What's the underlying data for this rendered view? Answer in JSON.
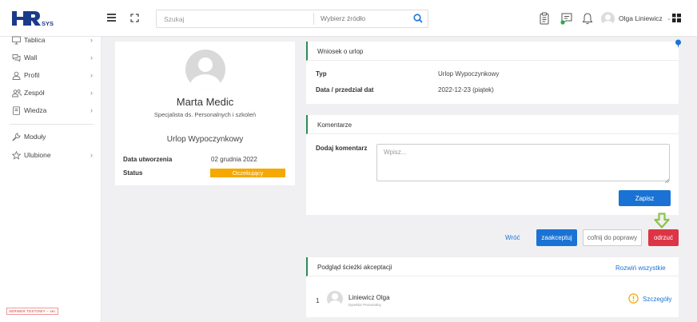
{
  "app": {
    "logo_text": "HRsys",
    "brand_color": "#1a3a8a"
  },
  "header": {
    "search": {
      "placeholder": "Szukaj",
      "value": ""
    },
    "source_select": {
      "label": "Wybierz źródło"
    },
    "icons": [
      "hamburger-icon",
      "fullscreen-icon",
      "search-icon",
      "clipboard-icon",
      "chat-icon",
      "bell-icon",
      "apps-grid-icon"
    ],
    "user": {
      "name": "Olga Liniewicz"
    }
  },
  "sidebar": {
    "items": [
      {
        "label": "Tablica",
        "icon": "monitor-icon",
        "has_children": true
      },
      {
        "label": "Wall",
        "icon": "comments-icon",
        "has_children": true
      },
      {
        "label": "Profil",
        "icon": "user-icon",
        "has_children": true
      },
      {
        "label": "Zespół",
        "icon": "team-icon",
        "has_children": true
      },
      {
        "label": "Wiedza",
        "icon": "book-icon",
        "has_children": true
      },
      {
        "label": "Moduły",
        "icon": "wrench-icon",
        "has_children": false
      },
      {
        "label": "Ulubione",
        "icon": "star-icon",
        "has_children": true
      }
    ],
    "server_badge": "SERWER TESTOWY – ver."
  },
  "profile": {
    "name": "Marta Medic",
    "role": "Specjalista ds. Personalnych i szkoleń",
    "leave_type": "Urlop Wypoczynkowy",
    "created_label": "Data utworzenia",
    "created_value": "02 grudnia 2022",
    "status_label": "Status",
    "status_value": "Oczekujący",
    "status_color": "#f5a800"
  },
  "leave_request": {
    "title": "Wniosek o urlop",
    "type_label": "Typ",
    "type_value": "Urlop Wypoczynkowy",
    "date_label": "Data / przedział dat",
    "date_value": "2022-12-23 (piątek)"
  },
  "comments": {
    "title": "Komentarze",
    "add_label": "Dodaj komentarz",
    "placeholder": "Wpisz...",
    "save_label": "Zapisz"
  },
  "actions": {
    "back": "Wróć",
    "accept": "zaakceptuj",
    "return": "cofnij do poprawy",
    "reject": "odrzuć",
    "accept_color": "#1a73d4",
    "reject_color": "#dc3545",
    "marker_color": "#8bc34a"
  },
  "approval_path": {
    "title": "Podgląd ścieżki akceptacji",
    "expand_all": "Rozwiń wszystkie",
    "rows": [
      {
        "number": "1",
        "name": "Liniewicz Olga",
        "role": "Dyrektor Personalny",
        "status_icon": "warning-icon",
        "details": "Szczegóły"
      }
    ]
  }
}
